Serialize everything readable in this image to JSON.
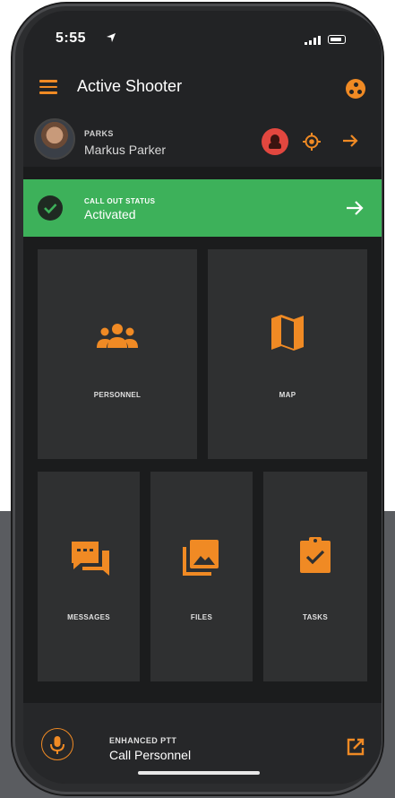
{
  "status_bar": {
    "time": "5:55"
  },
  "app_bar": {
    "title": "Active Shooter"
  },
  "user": {
    "team": "PARKS",
    "name": "Markus Parker"
  },
  "callout": {
    "label": "CALL OUT STATUS",
    "value": "Activated"
  },
  "tiles": {
    "personnel": "PERSONNEL",
    "map": "MAP",
    "messages": "MESSAGES",
    "files": "FILES",
    "tasks": "TASKS"
  },
  "ptt": {
    "label": "ENHANCED PTT",
    "value": "Call Personnel"
  },
  "colors": {
    "accent": "#f08a24",
    "success": "#3db15a",
    "alert": "#e2473f",
    "background": "#222325",
    "tile": "#2f3031"
  },
  "icons": [
    "location-arrow-icon",
    "signal-icon",
    "battery-icon",
    "menu-icon",
    "incident-icon",
    "alert-icon",
    "target-icon",
    "arrow-right-icon",
    "check-icon",
    "group-icon",
    "map-icon",
    "messages-icon",
    "files-icon",
    "tasks-icon",
    "microphone-icon",
    "open-external-icon"
  ]
}
